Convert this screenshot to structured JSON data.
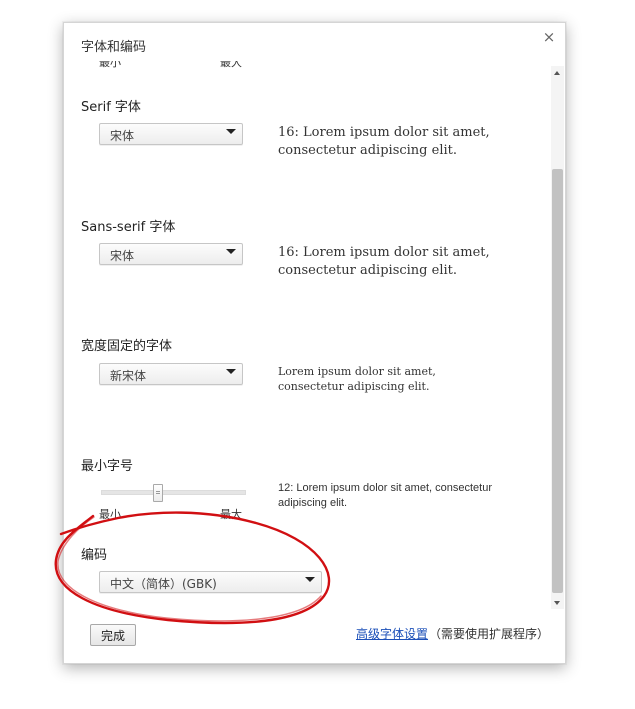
{
  "dialog": {
    "title": "字体和编码",
    "close_label": "×"
  },
  "sections": {
    "top_tick_labels": {
      "min": "最小",
      "max": "最大"
    },
    "serif": {
      "heading": "Serif 字体",
      "selected": "宋体",
      "sample_line1": "16: Lorem ipsum dolor sit amet,",
      "sample_line2": "consectetur adipiscing elit."
    },
    "sans_serif": {
      "heading": "Sans-serif 字体",
      "selected": "宋体",
      "sample_line1": "16: Lorem ipsum dolor sit amet,",
      "sample_line2": "consectetur adipiscing elit."
    },
    "fixed_width": {
      "heading": "宽度固定的字体",
      "selected": "新宋体",
      "sample_line1": "Lorem ipsum dolor sit amet,",
      "sample_line2": "consectetur adipiscing elit."
    },
    "min_font_size": {
      "heading": "最小字号",
      "min_label": "最小",
      "max_label": "最大",
      "slider_level": 0.39,
      "sample_line1": "12: Lorem ipsum dolor sit amet, consectetur",
      "sample_line2": "adipiscing elit."
    },
    "encoding": {
      "heading": "编码",
      "selected": "中文（简体）(GBK)"
    }
  },
  "footer": {
    "done_label": "完成",
    "advanced_link": "高级字体设置",
    "advanced_note": "（需要使用扩展程序）"
  },
  "colors": {
    "link": "#1b4fb8",
    "annotation": "#d10f12",
    "scroll_thumb": "#c2c2c2"
  },
  "icons": {
    "close": "close-icon",
    "dropdown_arrow": "chevron-down-icon",
    "scroll_up": "scroll-up-arrow-icon",
    "scroll_down": "scroll-down-arrow-icon"
  }
}
